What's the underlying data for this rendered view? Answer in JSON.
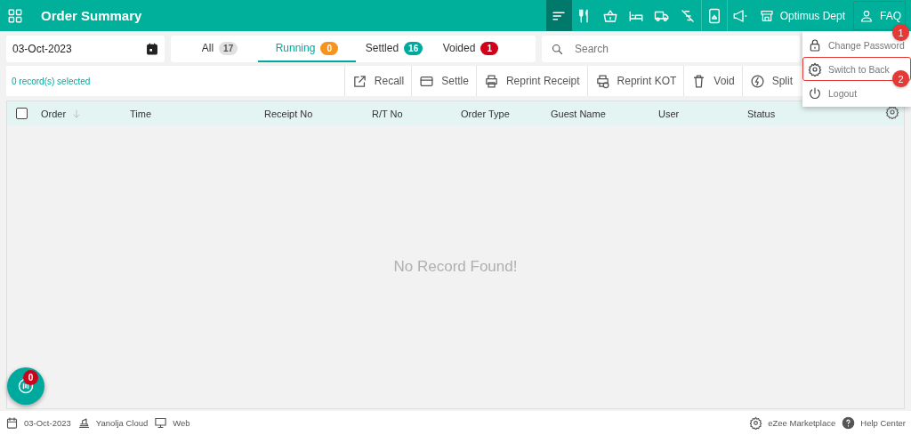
{
  "header": {
    "title": "Order Summary",
    "tools": [
      {
        "kind": "sort",
        "selected": true
      },
      {
        "kind": "cutlery",
        "selected": false
      },
      {
        "kind": "basket",
        "selected": false
      },
      {
        "kind": "bed",
        "selected": false
      },
      {
        "kind": "truck",
        "selected": false
      },
      {
        "kind": "slash",
        "selected": false
      },
      {
        "kind": "phone",
        "selected": false
      },
      {
        "kind": "megaphone",
        "selected": false
      }
    ],
    "outlet": "Optimus Dept",
    "user": "FAQ"
  },
  "date_field": {
    "value": "03-Oct-2023"
  },
  "tabs": [
    {
      "label": "All",
      "count": "17",
      "color": "#e0e0e0",
      "selected": false
    },
    {
      "label": "Running",
      "count": "0",
      "color": "#f7941d",
      "selected": true
    },
    {
      "label": "Settled",
      "count": "16",
      "color": "#00a99d",
      "selected": false
    },
    {
      "label": "Voided",
      "count": "1",
      "color": "#d0021b",
      "selected": false
    }
  ],
  "search": {
    "placeholder": "Search"
  },
  "toolbar": {
    "selection": "0 record(s) selected",
    "actions": [
      {
        "kind": "recall",
        "label": "Recall"
      },
      {
        "kind": "settle",
        "label": "Settle"
      },
      {
        "kind": "print",
        "label": "Reprint Receipt"
      },
      {
        "kind": "kot",
        "label": "Reprint KOT"
      },
      {
        "kind": "void",
        "label": "Void"
      },
      {
        "kind": "split",
        "label": "Split"
      }
    ]
  },
  "table": {
    "select_all": {
      "checked": false
    },
    "columns": [
      "Order",
      "Time",
      "Receipt No",
      "R/T No",
      "Order Type",
      "Guest Name",
      "User",
      "Status"
    ],
    "empty_message": "No Record Found!"
  },
  "user_menu": {
    "items": [
      {
        "kind": "lock",
        "label": "Change Password",
        "highlighted": false
      },
      {
        "kind": "gear",
        "label": "Switch to Back",
        "highlighted": true
      },
      {
        "kind": "power",
        "label": "Logout",
        "highlighted": false
      }
    ]
  },
  "callouts": [
    "1",
    "2"
  ],
  "notification_button": {
    "count": "0"
  },
  "status_bar": {
    "left": [
      {
        "kind": "calendar",
        "label": "03-Oct-2023"
      },
      {
        "kind": "cloud",
        "label": "Yanolja Cloud"
      },
      {
        "kind": "monitor",
        "label": "Web"
      }
    ],
    "right": [
      {
        "kind": "gear",
        "label": "eZee Marketplace"
      },
      {
        "kind": "help",
        "label": "Help Center"
      }
    ]
  }
}
